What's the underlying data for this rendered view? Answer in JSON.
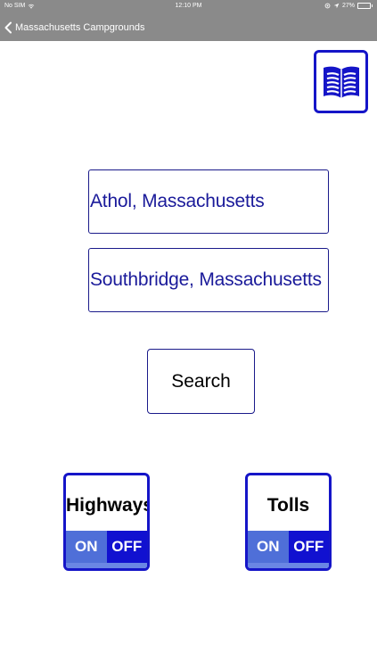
{
  "status_bar": {
    "carrier": "No SIM",
    "time": "12:10 PM",
    "battery": "27%",
    "battery_level": 0.27
  },
  "nav": {
    "back_label": "Massachusetts Campgrounds"
  },
  "form": {
    "from_value": "Athol, Massachusetts",
    "to_value": "Southbridge, Massachusetts",
    "search_label": "Search"
  },
  "toggles": {
    "highways": {
      "title": "Highways",
      "on_label": "ON",
      "off_label": "OFF"
    },
    "tolls": {
      "title": "Tolls",
      "on_label": "ON",
      "off_label": "OFF"
    }
  },
  "icons": {
    "book": "book-icon",
    "back": "chevron-left-icon",
    "wifi": "wifi-icon",
    "location": "location-arrow-icon",
    "orientation": "orientation-lock-icon",
    "battery": "battery-icon"
  },
  "colors": {
    "bar": "#8a8a8a",
    "accent": "#1515c8",
    "text_blue": "#1a1a9a",
    "toggle_on": "#4f6fd8",
    "toggle_off": "#1111d0"
  }
}
